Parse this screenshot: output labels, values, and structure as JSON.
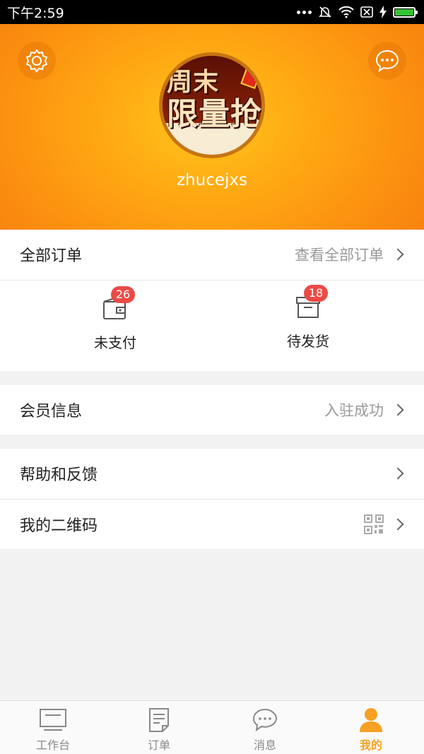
{
  "status_bar": {
    "time": "下午2:59"
  },
  "profile": {
    "username": "zhucejxs",
    "avatar_text_line1": "周末",
    "avatar_text_line2": "限量抢"
  },
  "orders": {
    "title": "全部订单",
    "view_all": "查看全部订单",
    "items": [
      {
        "label": "未支付",
        "count": "26",
        "icon": "wallet-icon"
      },
      {
        "label": "待发货",
        "count": "18",
        "icon": "box-icon"
      }
    ]
  },
  "member": {
    "title": "会员信息",
    "status": "入驻成功"
  },
  "help": {
    "title": "帮助和反馈"
  },
  "qrcode": {
    "title": "我的二维码"
  },
  "tabs": [
    {
      "label": "工作台",
      "icon": "monitor-icon"
    },
    {
      "label": "订单",
      "icon": "document-icon"
    },
    {
      "label": "消息",
      "icon": "chat-bubble-icon"
    },
    {
      "label": "我的",
      "icon": "person-icon",
      "active": true
    }
  ],
  "colors": {
    "accent": "#f6a123",
    "badge": "#ec4a45",
    "header": "#fb8f10"
  }
}
